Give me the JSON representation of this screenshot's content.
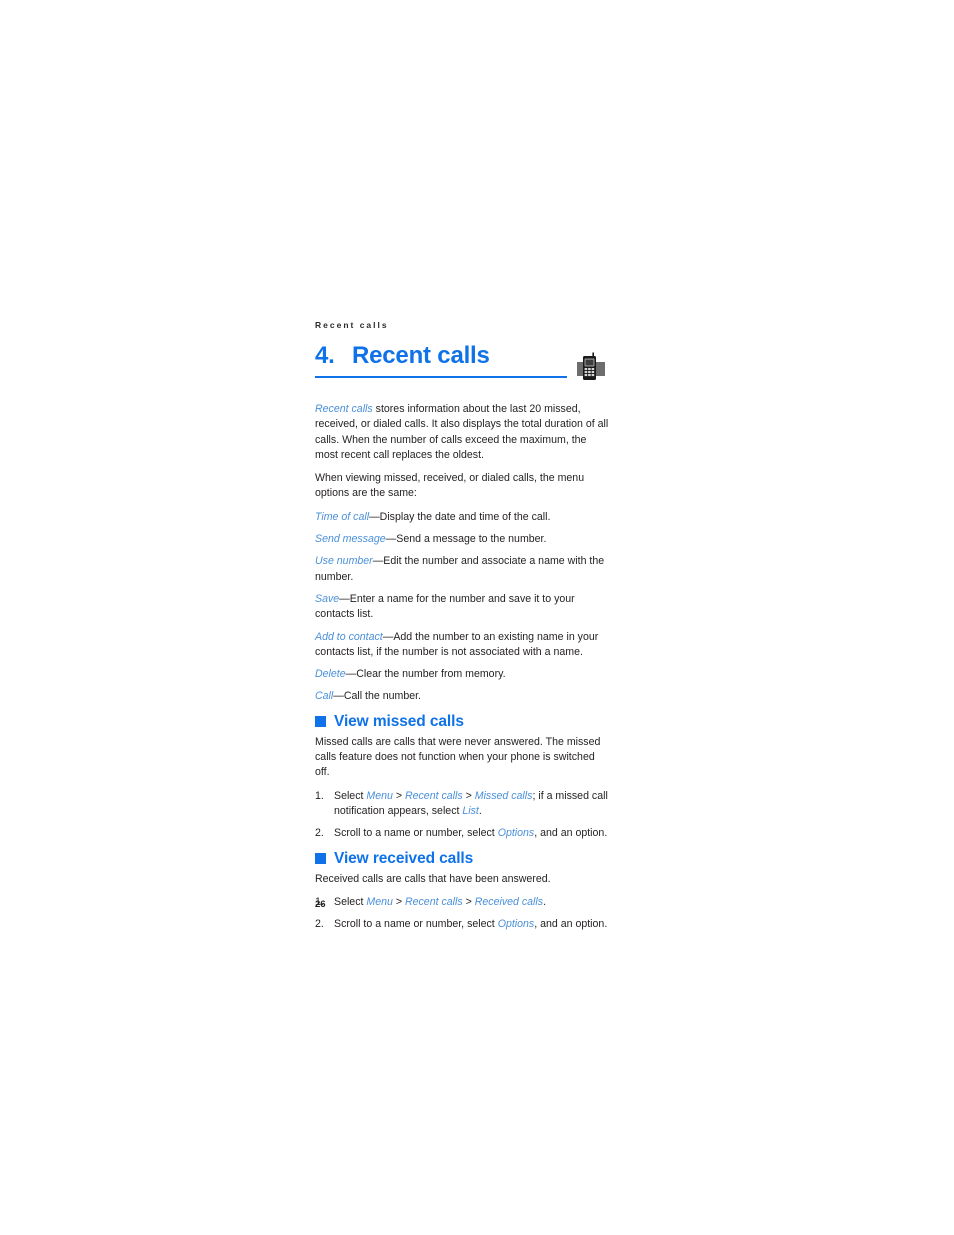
{
  "document": {
    "running_head": "Recent calls",
    "page_number": "26"
  },
  "chapter": {
    "number": "4.",
    "title": "Recent calls",
    "icon": "mobile-phone-icon",
    "rule_color": "#0f72e8",
    "title_color": "#0f72e8"
  },
  "intro": {
    "paragraph1_lead": "Recent calls",
    "paragraph1_rest": " stores information about the last 20 missed, received, or dialed calls. It also displays the total duration of all calls. When the number of calls exceed the maximum, the most recent call replaces the oldest.",
    "paragraph2": "When viewing missed, received, or dialed calls, the menu options are the same:"
  },
  "options": [
    {
      "term": "Time of call",
      "desc": "—Display the date and time of the call."
    },
    {
      "term": "Send message",
      "desc": "—Send a message to the number."
    },
    {
      "term": "Use number",
      "desc": "—Edit the number and associate a name with the number."
    },
    {
      "term": "Save",
      "desc": "—Enter a name for the number and save it to your contacts list."
    },
    {
      "term": "Add to contact",
      "desc": "—Add the number to an existing name in your contacts list, if the number is not associated with a name."
    },
    {
      "term": "Delete",
      "desc": "—Clear the number from memory."
    },
    {
      "term": "Call",
      "desc": "—Call the number."
    }
  ],
  "sections": [
    {
      "heading": "View missed calls",
      "bullet_color": "#0f72e8",
      "intro": "Missed calls are calls that were never answered. The missed calls feature does not function when your phone is switched off.",
      "steps": [
        {
          "number": "1.",
          "parts": [
            {
              "text": "Select ",
              "ui": false
            },
            {
              "text": "Menu",
              "ui": true
            },
            {
              "text": " > ",
              "ui": false
            },
            {
              "text": "Recent calls",
              "ui": true
            },
            {
              "text": " > ",
              "ui": false
            },
            {
              "text": "Missed calls",
              "ui": true
            },
            {
              "text": "; if a missed call notification appears, select ",
              "ui": false
            },
            {
              "text": "List",
              "ui": true
            },
            {
              "text": ".",
              "ui": false
            }
          ]
        },
        {
          "number": "2.",
          "parts": [
            {
              "text": "Scroll to a name or number, select ",
              "ui": false
            },
            {
              "text": "Options",
              "ui": true
            },
            {
              "text": ", and an option.",
              "ui": false
            }
          ]
        }
      ]
    },
    {
      "heading": "View received calls",
      "bullet_color": "#0f72e8",
      "intro": "Received calls are calls that have been answered.",
      "steps": [
        {
          "number": "1.",
          "parts": [
            {
              "text": "Select ",
              "ui": false
            },
            {
              "text": "Menu",
              "ui": true
            },
            {
              "text": " > ",
              "ui": false
            },
            {
              "text": "Recent calls",
              "ui": true
            },
            {
              "text": " > ",
              "ui": false
            },
            {
              "text": "Received calls",
              "ui": true
            },
            {
              "text": ".",
              "ui": false
            }
          ]
        },
        {
          "number": "2.",
          "parts": [
            {
              "text": "Scroll to a name or number, select ",
              "ui": false
            },
            {
              "text": "Options",
              "ui": true
            },
            {
              "text": ", and an option.",
              "ui": false
            }
          ]
        }
      ]
    }
  ]
}
